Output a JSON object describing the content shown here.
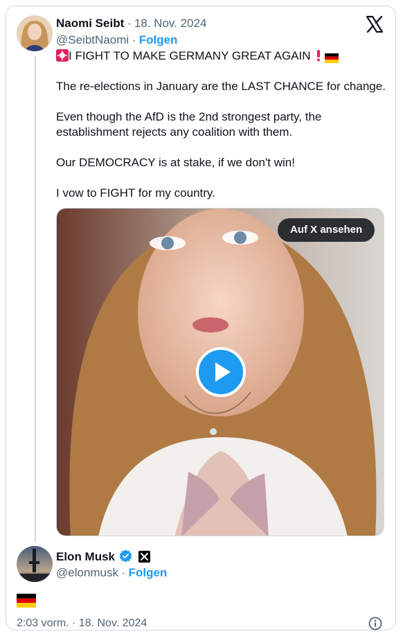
{
  "tweet": {
    "author": {
      "name": "Naomi Seibt",
      "date": "18. Nov. 2024",
      "handle": "@SeibtNaomi",
      "follow_label": "Folgen"
    },
    "lines": [
      "I FIGHT TO MAKE GERMANY GREAT AGAIN",
      "The re-elections in January are the LAST CHANCE for change.",
      "Even though the AfD is the 2nd strongest party, the",
      "establishment rejects any coalition with them.",
      "Our DEMOCRACY is at stake, if we don't win!",
      "I vow to FIGHT for my country."
    ],
    "media": {
      "view_on_x_label": "Auf X ansehen"
    }
  },
  "reply": {
    "author": {
      "name": "Elon Musk",
      "handle": "@elonmusk",
      "follow_label": "Folgen"
    }
  },
  "footer": {
    "timestamp": "2:03 vorm. · 18. Nov. 2024"
  },
  "icons": [
    "x-logo-icon",
    "siren-icon",
    "exclamation-icon",
    "german-flag-icon",
    "verified-badge-icon",
    "x-affiliate-icon",
    "play-icon",
    "info-icon"
  ],
  "colors": {
    "accent": "#1d9bf0",
    "text": "#0f1419",
    "muted": "#536471",
    "border": "#cfd9de"
  }
}
